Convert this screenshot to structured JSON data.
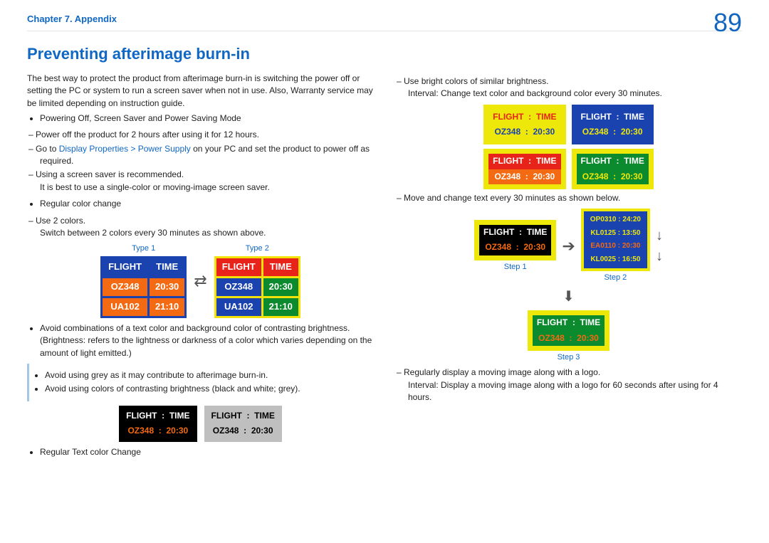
{
  "header": {
    "chapter": "Chapter 7. Appendix",
    "page": "89"
  },
  "title": "Preventing afterimage burn-in",
  "intro": "The best way to protect the product from afterimage burn-in is switching the power off or setting the PC or system to run a screen saver when not in use. Also, Warranty service may be limited depending on instruction guide.",
  "b1": "Powering Off, Screen Saver and Power Saving Mode",
  "b1a": "Power off the product for 2 hours after using it for 12 hours.",
  "b1b_pre": "Go to ",
  "b1b_link": "Display Properties > Power Supply",
  "b1b_post": " on your PC and set the product to power off as required.",
  "b1c": "Using a screen saver is recommended.",
  "b1c2": "It is best to use a single-color or moving-image screen saver.",
  "b2": "Regular color change",
  "b2a": "Use 2 colors.",
  "b2a2": "Switch between 2 colors every 30 minutes as shown above.",
  "type1": "Type 1",
  "type2": "Type 2",
  "ft": {
    "h1": "FLIGHT",
    "h2": "TIME",
    "r1c1": "OZ348",
    "r1c2": "20:30",
    "r2c1": "UA102",
    "r2c2": "21:10"
  },
  "b3": "Avoid combinations of a text color and background color of contrasting brightness.",
  "b3sub": "(Brightness: refers to the lightness or darkness of a color which varies depending on the amount of light emitted.)",
  "note1": "Avoid using grey as it may contribute to afterimage burn-in.",
  "note2": "Avoid using colors of contrasting brightness (black and white; grey).",
  "ex3": {
    "flight": "FLIGHT",
    "time": "TIME",
    "code": "OZ348",
    "t": "20:30"
  },
  "b4": "Regular Text color Change",
  "right": {
    "d1": "Use bright colors of similar brightness.",
    "d1b": "Interval: Change text color and background color every 30 minutes.",
    "d2": "Move and change text every 30 minutes as shown below.",
    "step1": "Step 1",
    "step2": "Step 2",
    "step3": "Step 3",
    "step2rows": [
      "OP0310  :  24:20",
      "KL0125  :  13:50",
      "EA0110  :  20:30",
      "KL0025  :  16:50"
    ],
    "d3": "Regularly display a moving image along with a logo.",
    "d3b": "Interval: Display a moving image along with a logo for 60 seconds after using for 4 hours."
  }
}
